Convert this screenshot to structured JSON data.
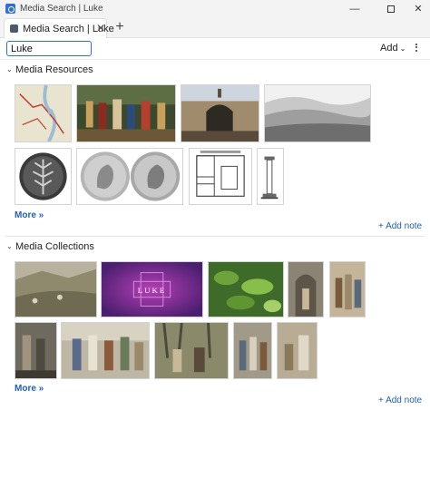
{
  "window": {
    "title": "Media Search | Luke",
    "minimize_glyph": "—",
    "close_glyph": "✕"
  },
  "tab": {
    "label": "Media Search | Luke",
    "close_glyph": "✕",
    "new_tab_glyph": "+"
  },
  "toolbar": {
    "search_value": "Luke",
    "add_label": "Add",
    "add_chevron": "⌄"
  },
  "sections": {
    "media_resources": {
      "chevron": "⌄",
      "title": "Media Resources",
      "more_label": "More »",
      "add_note_label": "+ Add note",
      "thumbnails": [
        {
          "name": "map",
          "icon": "map-thumbnail"
        },
        {
          "name": "painting",
          "icon": "painting-thumbnail"
        },
        {
          "name": "gate-photo",
          "icon": "photo-thumbnail"
        },
        {
          "name": "landscape-engraving",
          "icon": "engraving-thumbnail"
        },
        {
          "name": "coin",
          "icon": "coin-thumbnail"
        },
        {
          "name": "two-coins",
          "icon": "coin-thumbnail"
        },
        {
          "name": "floor-plan",
          "icon": "plan-thumbnail"
        },
        {
          "name": "column-drawing",
          "icon": "column-thumbnail"
        }
      ]
    },
    "media_collections": {
      "chevron": "⌄",
      "title": "Media Collections",
      "more_label": "More »",
      "add_note_label": "+ Add note",
      "luke_card_text": "LUKE"
    }
  }
}
